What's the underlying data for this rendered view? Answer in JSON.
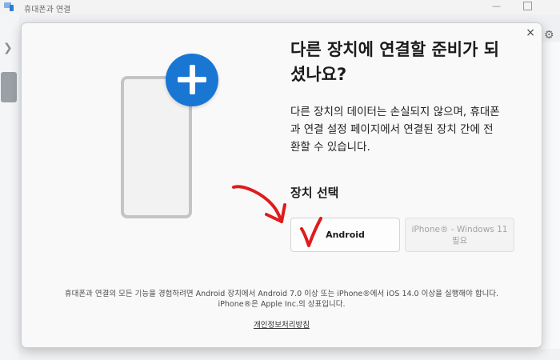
{
  "app": {
    "title": "휴대폰과 연결"
  },
  "dialog": {
    "heading_line1": "다른 장치에 연결할 준비가 되",
    "heading_line2": "셨나요?",
    "description_line1": "다른 장치의 데이터는 손실되지 않으며, 휴대폰",
    "description_line2": "과 연결 설정 페이지에서 연결된 장치 간에 전",
    "description_line3": "환할 수 있습니다.",
    "section_title": "장치 선택",
    "android_button": "Android",
    "iphone_button_line1": "iPhone® - Windows 11",
    "iphone_button_line2": "필요",
    "footer_line1": "휴대폰과 연결의 모든 기능을 경험하려면 Android 장치에서 Android 7.0 이상 또는 iPhone®에서 iOS 14.0 이상을 실행해야 합니다.",
    "footer_line2": "iPhone®은 Apple Inc.의 상표입니다.",
    "privacy_link": "개인정보처리방침",
    "close_glyph": "×"
  },
  "icons": {
    "back": "chevron-right-icon",
    "settings": "gear-icon",
    "add": "plus-icon"
  },
  "colors": {
    "accent": "#1976d2",
    "annotation": "#e01b1b"
  }
}
